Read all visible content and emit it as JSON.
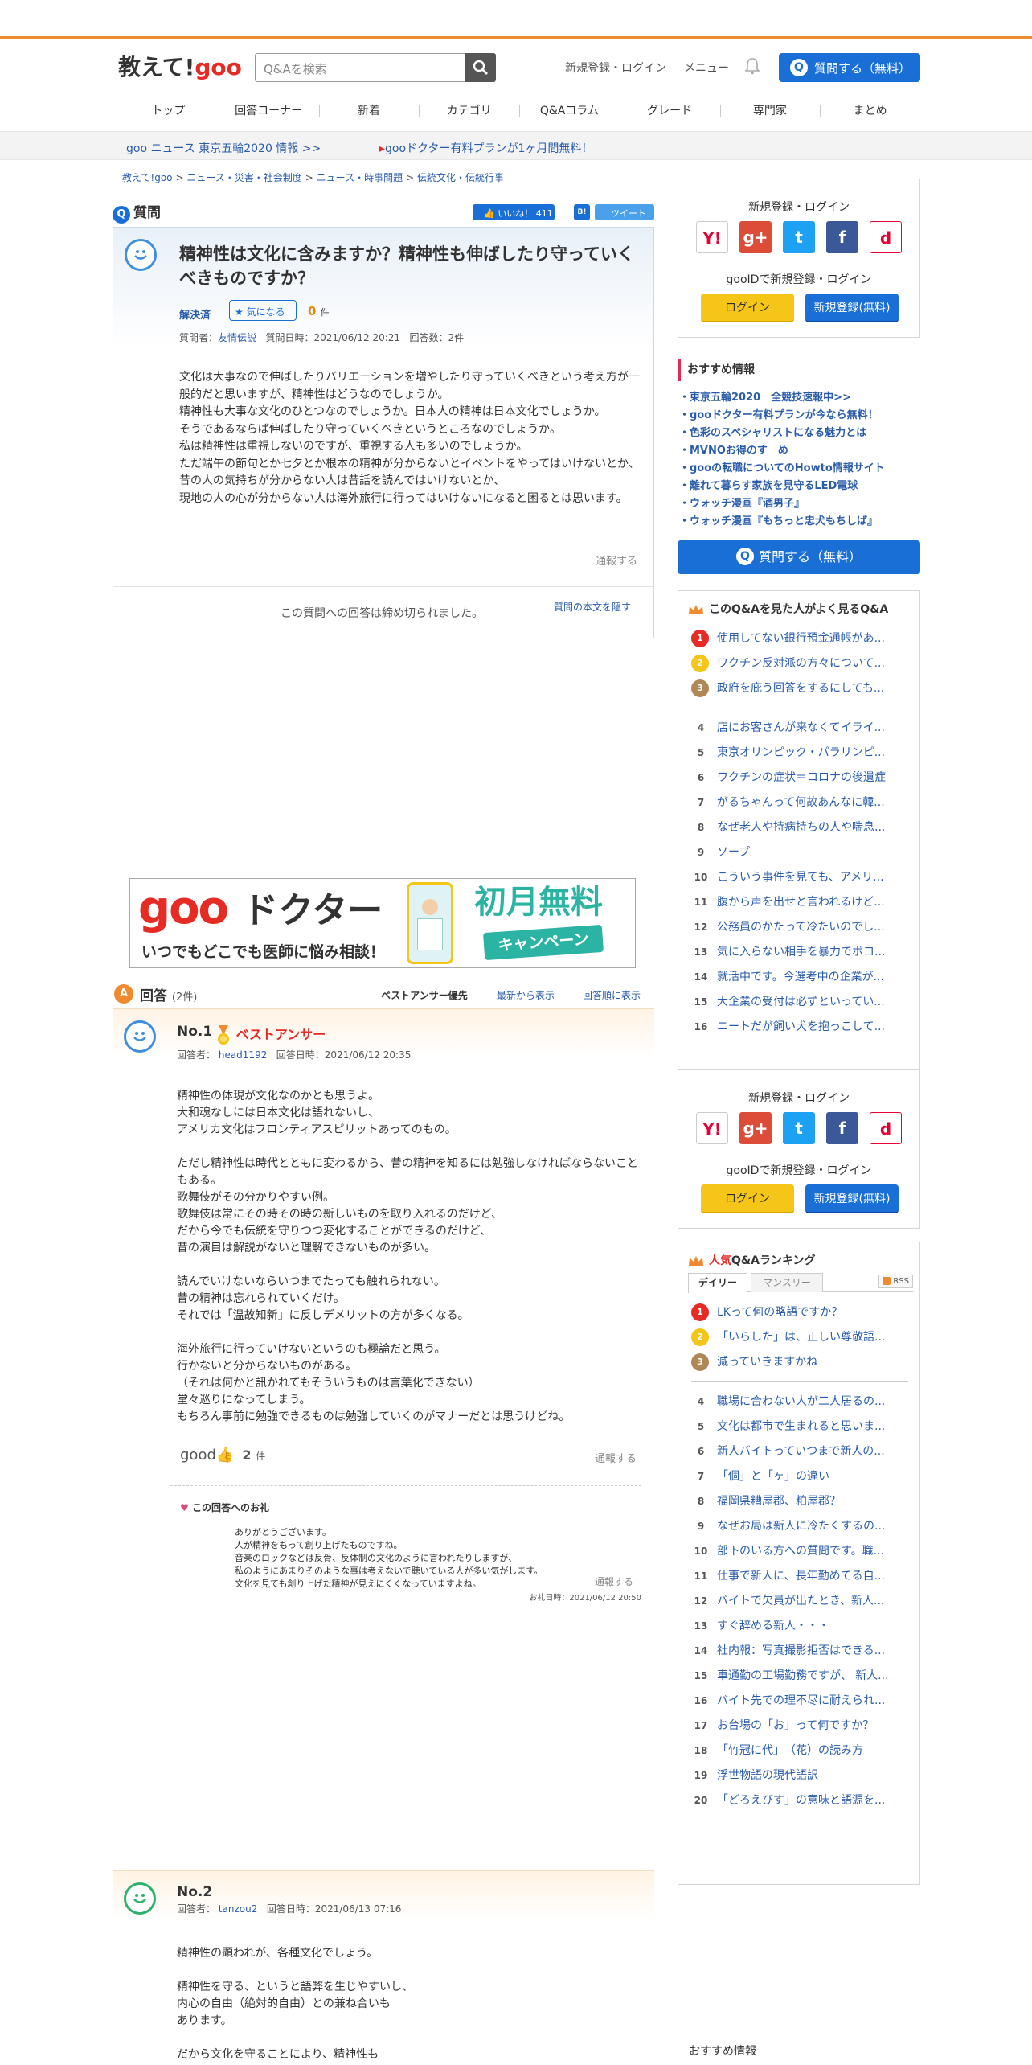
{
  "header": {
    "logo_text": "教えて!",
    "logo_brand": "goo",
    "search_placeholder": "Q&Aを検索",
    "login_link": "新規登録・ログイン",
    "menu_link": "メニュー",
    "ask_button": "質問する（無料）"
  },
  "nav": [
    "トップ",
    "回答コーナー",
    "新着",
    "カテゴリ",
    "Q&Aコラム",
    "グレード",
    "専門家",
    "まとめ"
  ],
  "newsbar": [
    "goo ニュース 東京五輪2020 情報 >>",
    "gooドクター有料プランが1ヶ月間無料！"
  ],
  "breadcrumb": [
    "教えて!goo",
    "ニュース・災害・社会制度",
    "ニュース・時事問題",
    "伝統文化・伝統行事"
  ],
  "question": {
    "heading": "質問",
    "like_label": "いいね！",
    "like_count": "411",
    "b_label": "B!",
    "tweet_label": "ツイート",
    "title": "精神性は文化に含みますか？精神性も伸ばしたり守っていくべきものですか？",
    "status": "解決済",
    "kininaru_label": "気になる",
    "kininaru_count": "0",
    "kininaru_unit": "件",
    "asker_label": "質問者：",
    "asker": "友情伝説",
    "date": "質問日時：2021/06/12 20:21",
    "answer_count": "回答数：2件",
    "body": "文化は大事なので伸ばしたりバリエーションを増やしたり守っていくべきという考え方が一般的だと思いますが、精神性はどうなのでしょうか。\n精神性も大事な文化のひとつなのでしょうか。日本人の精神は日本文化でしょうか。\nそうであるならば伸ばしたり守っていくべきというところなのでしょうか。\n私は精神性は重視しないのですが、重視する人も多いのでしょうか。\nただ端午の節句とか七夕とか根本の精神が分からないとイベントをやってはいけないとか、\n昔の人の気持ちが分からない人は昔話を読んではいけないとか、\n現地の人の心が分からない人は海外旅行に行ってはいけないになると困るとは思います。",
    "report": "通報する",
    "closed_text": "この質問への回答は締め切られました。",
    "hide_link": "質問の本文を隠す"
  },
  "banner": {
    "brand": "goo",
    "brand2": "ドクター",
    "tagline": "いつでもどこでも医師に悩み相談！",
    "promo": "初月無料",
    "promo2": "キャンペーン"
  },
  "answers_header": {
    "title": "回答",
    "count": "(2件)",
    "sort": [
      "ベストアンサー優先",
      "最新から表示",
      "回答順に表示"
    ]
  },
  "answer1": {
    "no": "No.1",
    "best": "ベストアンサー",
    "author_label": "回答者：",
    "author": "head1192",
    "date": "回答日時：2021/06/12 20:35",
    "body": "精神性の体現が文化なのかとも思うよ。\n大和魂なしには日本文化は語れないし、\nアメリカ文化はフロンティアスピリットあってのもの。\n\nただし精神性は時代とともに変わるから、昔の精神を知るには勉強しなければならないこともある。\n歌舞伎がその分かりやすい例。\n歌舞伎は常にその時その時の新しいものを取り入れるのだけど、\nだから今でも伝統を守りつつ変化することができるのだけど、\n昔の演目は解説がないと理解できないものが多い。\n\n読んでいけないならいつまでたっても触れられない。\n昔の精神は忘れられていくだけ。\nそれでは「温故知新」に反しデメリットの方が多くなる。\n\n海外旅行に行っていけないというのも極論だと思う。\n行かないと分からないものがある。\n（それは何かと訊かれてもそういうものは言葉化できない）\n堂々巡りになってしまう。\nもちろん事前に勉強できるものは勉強していくのがマナーだとは思うけどね。",
    "good_label": "good",
    "good_count": "2",
    "good_unit": "件",
    "report": "通報する",
    "thanks_title": "この回答へのお礼",
    "thanks_body": "ありがとうございます。\n人が精神をもって創り上げたものですね。\n音楽のロックなどは反骨、反体制の文化のように言われたりしますが、\n私のようにあまりそのような事は考えないで聴いている人が多い気がします。\n文化を見ても創り上げた精神が見えにくくなっていますよね。",
    "thanks_report": "通報する",
    "thanks_date": "お礼日時：2021/06/12 20:50"
  },
  "answer2": {
    "no": "No.2",
    "author_label": "回答者：",
    "author": "tanzou2",
    "date": "回答日時：2021/06/13 07:16",
    "body": "精神性の顕われが、各種文化でしょう。\n\n精神性を守る、というと語弊を生じやすいし、\n内心の自由（絶対的自由）との兼ね合いも\nあります。\n\nだから文化を守ることにより、精神性も"
  },
  "sidebar": {
    "reg_title": "新規登録・ログイン",
    "gooid_text": "gooIDで新規登録・ログイン",
    "login_btn": "ログイン",
    "signup_btn": "新規登録(無料)",
    "sns": [
      {
        "label": "Y!",
        "color": "#ffffff"
      },
      {
        "label": "g+",
        "color": "#dd4b39"
      },
      {
        "label": "t",
        "color": "#1da1f2"
      },
      {
        "label": "f",
        "color": "#3b5998"
      },
      {
        "label": "d",
        "color": "#e60033"
      }
    ],
    "osusume_title": "おすすめ情報",
    "osusume": [
      "・東京五輪2020　全競技速報中>>",
      "・gooドクター有料プランが今なら無料！",
      "・色彩のスペシャリストになる魅力とは",
      "・MVNOお得のす　め",
      "・gooの転職についてのHowto情報サイト",
      "・離れて暮らす家族を見守るLED電球",
      "・ウォッチ漫画『酒男子』",
      "・ウォッチ漫画『もちっと忠犬もちしば』"
    ],
    "ask_button": "質問する（無料）",
    "popular_title": "このQ&Aを見た人がよく見るQ&A",
    "popular": [
      "使用してない銀行預金通帳があ...",
      "ワクチン反対派の方々について...",
      "政府を庇う回答をするにしても...",
      "店にお客さんが来なくてイライ...",
      "東京オリンピック・パラリンピ...",
      "ワクチンの症状＝コロナの後遺症",
      "がるちゃんって何故あんなに韓...",
      "なぜ老人や持病持ちの人や喘息...",
      "ソープ",
      "こういう事件を見ても、アメリ...",
      "腹から声を出せと言われるけど...",
      "公務員のかたって冷たいのでし...",
      "気に入らない相手を暴力でボコ...",
      "就活中です。今選考中の企業が...",
      "大企業の受付は必ずといってい...",
      "ニートだが飼い犬を抱っこして..."
    ],
    "ranking_title_a": "人気",
    "ranking_title_b": "Q&Aランキング",
    "tab_daily": "デイリー",
    "tab_monthly": "マンスリー",
    "rss": "RSS",
    "ranking": [
      "LKって何の略語ですか？",
      "「いらした」は、正しい尊敬語...",
      "減っていきますかね",
      "職場に合わない人が二人居るの...",
      "文化は都市で生まれると思いま...",
      "新人バイトっていつまで新人の...",
      "「個」と「ヶ」の違い",
      "福岡県糟屋郡、粕屋郡？",
      "なぜお局は新人に冷たくするの...",
      "部下のいる方への質問です。職...",
      "仕事で新人に、長年勤めてる自...",
      "バイトで欠員が出たとき、新人...",
      "すぐ辞める新人・・・",
      "社内報：写真撮影拒否はできる...",
      "車通勤の工場勤務ですが、 新人...",
      "バイト先での理不尽に耐えられ...",
      "お台場の「お」って何ですか？",
      "「竹冠に代」　（花）の読み方",
      "浮世物語の現代語訳",
      "「どろえびす」の意味と語源を..."
    ],
    "bottom_title": "おすすめ情報"
  },
  "colors": {
    "accent": "#f08a2e",
    "primary": "#1a6fd6",
    "link": "#2a5caa",
    "best": "#e62a24"
  }
}
